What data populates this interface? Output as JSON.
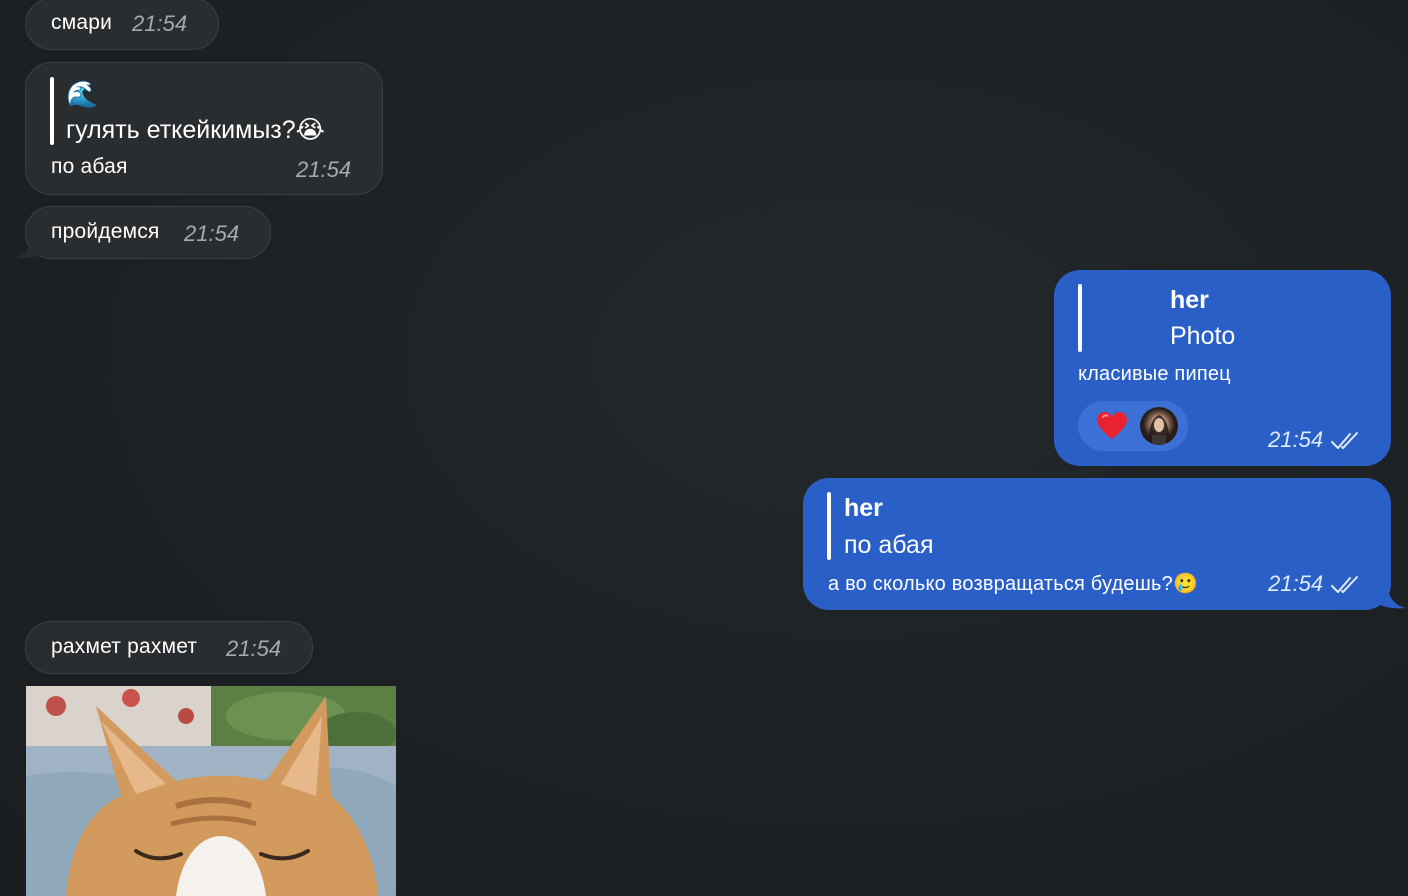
{
  "messages": {
    "m1": {
      "text": "смари",
      "time": "21:54"
    },
    "m2": {
      "quote_emoji": "🌊",
      "quote_text": "гулять еткейкимыз?😭",
      "text": "по абая",
      "time": "21:54"
    },
    "m3": {
      "text": "пройдемся",
      "time": "21:54"
    },
    "m4": {
      "quote_author": "her",
      "quote_text": "Photo",
      "text": "класивые пипец",
      "reaction": "❤️",
      "time": "21:54"
    },
    "m5": {
      "quote_author": "her",
      "quote_text": "по абая",
      "text": "а во сколько возвращаться будешь?🥲",
      "time": "21:54"
    },
    "m6": {
      "text": "рахмет рахмет",
      "time": "21:54"
    }
  },
  "colors": {
    "background": "#1d2124",
    "incoming_bubble": "#2a2d30",
    "outgoing_bubble": "#2a5fc8"
  },
  "icons": {
    "read_receipt": "double-check-icon",
    "reaction_heart": "heart-icon"
  }
}
